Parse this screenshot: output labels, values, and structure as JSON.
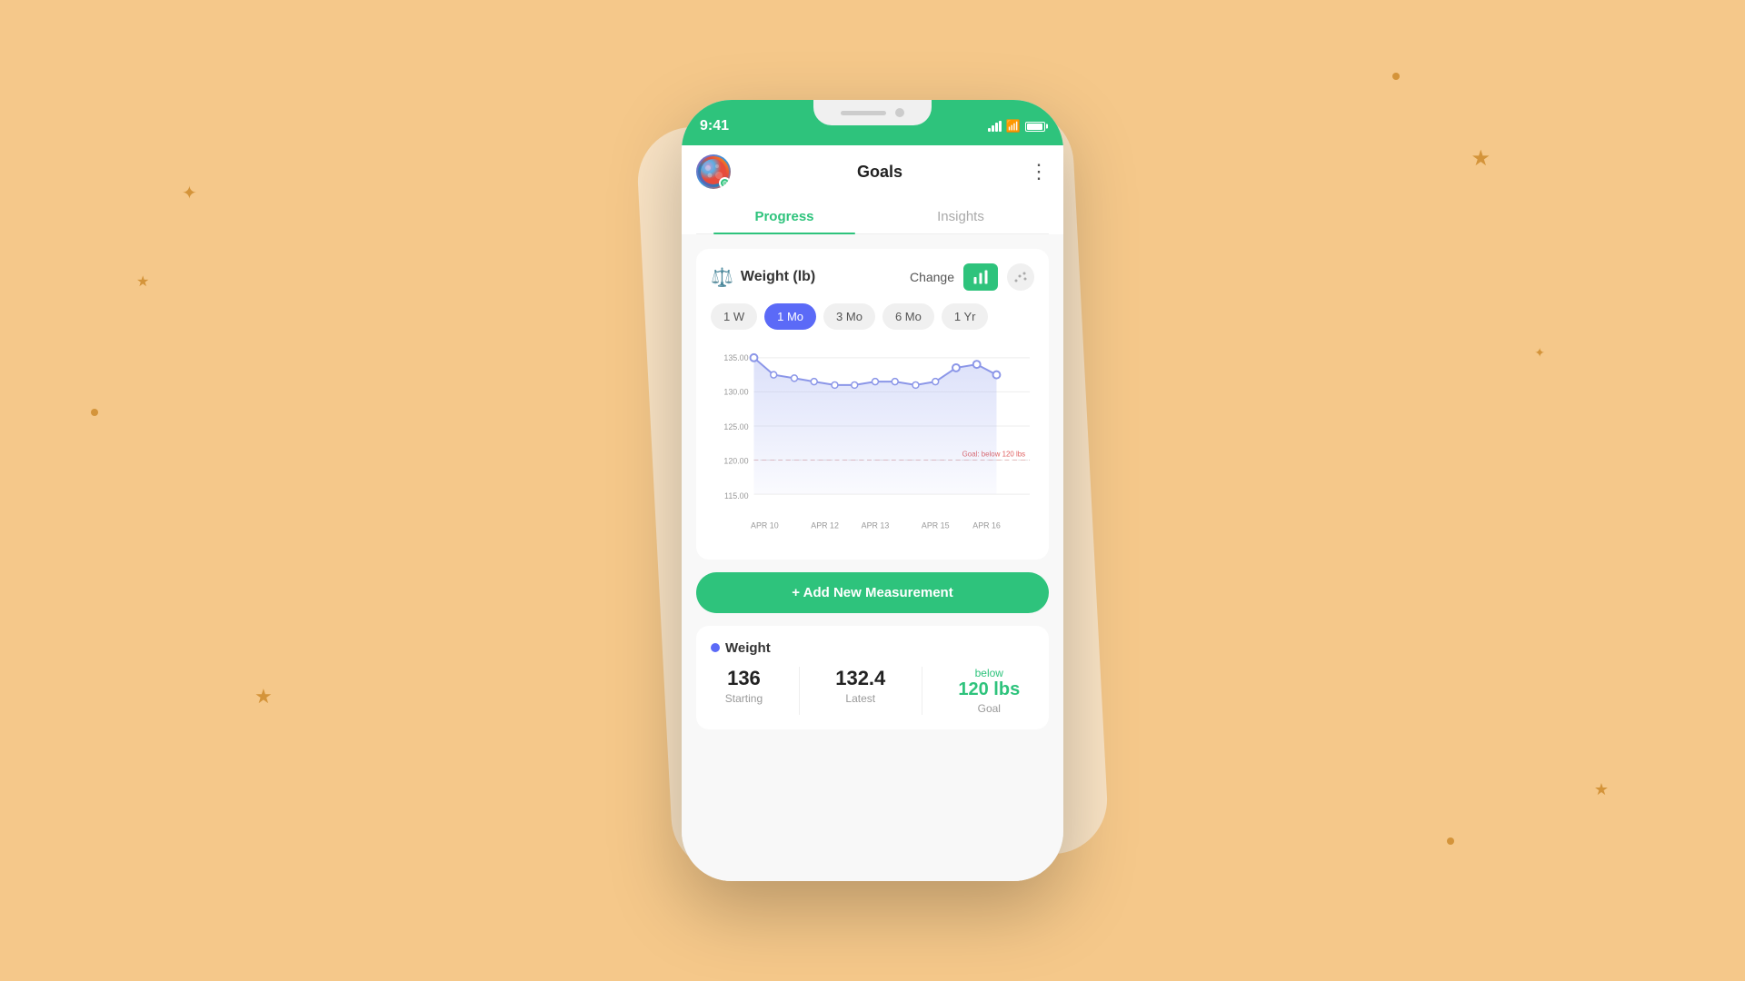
{
  "background": {
    "color": "#f5c88a"
  },
  "phone": {
    "status_bar": {
      "time": "9:41",
      "color": "#2ec37c"
    },
    "header": {
      "title": "Goals",
      "more_icon": "⋮"
    },
    "tabs": [
      {
        "id": "progress",
        "label": "Progress",
        "active": true
      },
      {
        "id": "insights",
        "label": "Insights",
        "active": false
      }
    ],
    "weight_section": {
      "icon": "⚖",
      "title": "Weight (lb)",
      "change_label": "Change",
      "time_ranges": [
        {
          "label": "1 W",
          "active": false
        },
        {
          "label": "1 Mo",
          "active": true
        },
        {
          "label": "3 Mo",
          "active": false
        },
        {
          "label": "6 Mo",
          "active": false
        },
        {
          "label": "1 Yr",
          "active": false
        }
      ],
      "chart": {
        "y_labels": [
          "135.00",
          "130.00",
          "125.00",
          "120.00",
          "115.00"
        ],
        "x_labels": [
          "APR 10",
          "APR 12",
          "APR 13",
          "APR 15",
          "APR 16"
        ],
        "goal_label": "Goal: below 120 lbs",
        "goal_value": 120,
        "data_points": [
          135,
          132.5,
          132,
          131.5,
          131,
          131,
          131.5,
          131.5,
          131,
          131.5,
          133.5,
          134,
          132.5
        ]
      },
      "add_button_label": "+ Add New Measurement"
    },
    "stats": {
      "dot_color": "#5b6af7",
      "label": "Weight",
      "starting_value": "136",
      "starting_label": "Starting",
      "latest_value": "132.4",
      "latest_label": "Latest",
      "goal_value": "120 lbs",
      "goal_prefix": "below",
      "goal_label": "Goal"
    }
  },
  "decorations": {
    "stars": [
      "★",
      "★",
      "★",
      "★"
    ],
    "sparkles": [
      "✦",
      "✦"
    ]
  }
}
